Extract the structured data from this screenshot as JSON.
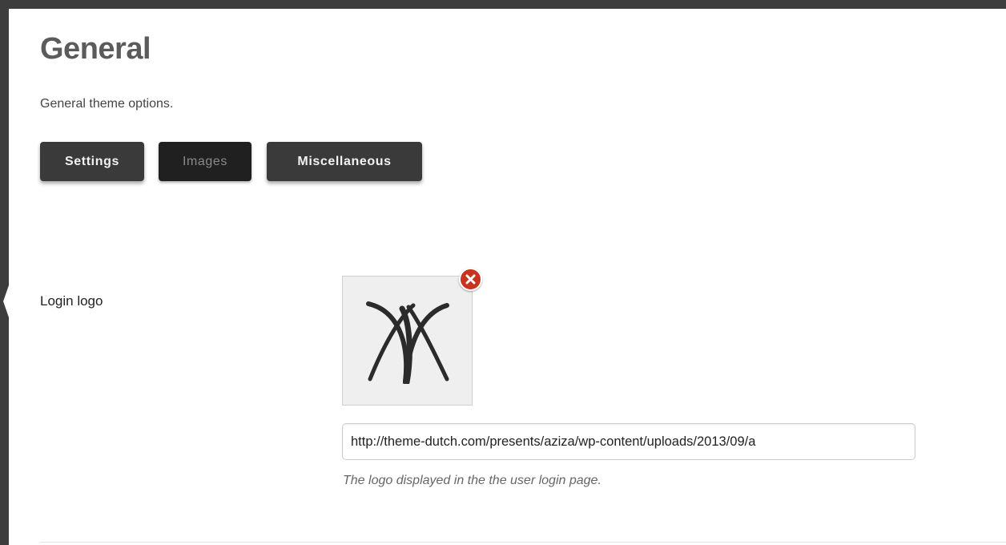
{
  "header": {
    "title": "General",
    "description": "General theme options."
  },
  "tabs": [
    {
      "label": "Settings",
      "active": false
    },
    {
      "label": "Images",
      "active": true
    },
    {
      "label": "Miscellaneous",
      "active": false
    }
  ],
  "login_logo": {
    "label": "Login logo",
    "url_value": "http://theme-dutch.com/presents/aziza/wp-content/uploads/2013/09/a",
    "help_text": "The logo displayed in the the user login page.",
    "remove_icon": "close-icon"
  },
  "colors": {
    "frame": "#3d3d3d",
    "tab_bg": "#3a3a3a",
    "tab_active_bg": "#202020",
    "remove_button": "#c7341f"
  }
}
